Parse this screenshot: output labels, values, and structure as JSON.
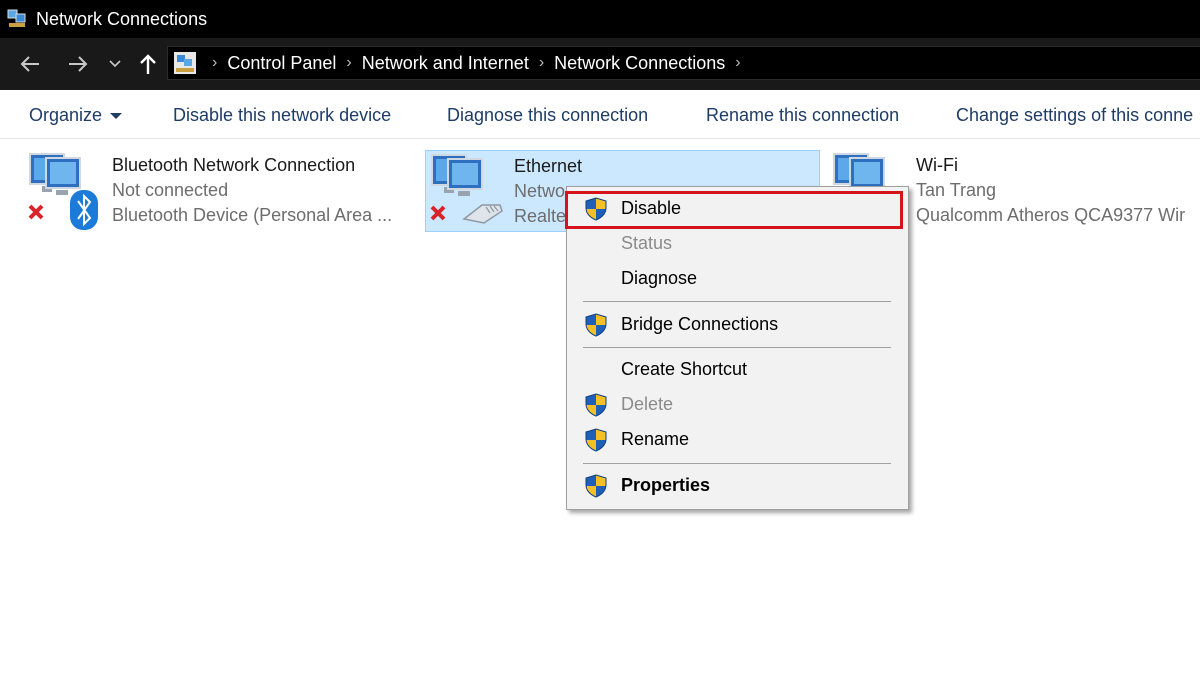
{
  "window": {
    "title": "Network Connections"
  },
  "breadcrumb": [
    "Control Panel",
    "Network and Internet",
    "Network Connections"
  ],
  "commands": [
    {
      "label": "Organize"
    },
    {
      "label": "Disable this network device"
    },
    {
      "label": "Diagnose this connection"
    },
    {
      "label": "Rename this connection"
    },
    {
      "label": "Change settings of this conne"
    }
  ],
  "connections": [
    {
      "name": "Bluetooth Network Connection",
      "status": "Not connected",
      "device": "Bluetooth Device (Personal Area ..."
    },
    {
      "name": "Ethernet",
      "status": "Netwo",
      "device": "Realte"
    },
    {
      "name": "Wi-Fi",
      "status": "Tan Trang",
      "device": "Qualcomm Atheros QCA9377 Wir"
    }
  ],
  "context_menu": {
    "items": [
      {
        "label": "Disable"
      },
      {
        "label": "Status"
      },
      {
        "label": "Diagnose"
      },
      {
        "label": "Bridge Connections"
      },
      {
        "label": "Create Shortcut"
      },
      {
        "label": "Delete"
      },
      {
        "label": "Rename"
      },
      {
        "label": "Properties"
      }
    ]
  },
  "colors": {
    "highlight": "#d6121a",
    "selection": "#cce8ff",
    "command_text": "#1e3c66"
  }
}
